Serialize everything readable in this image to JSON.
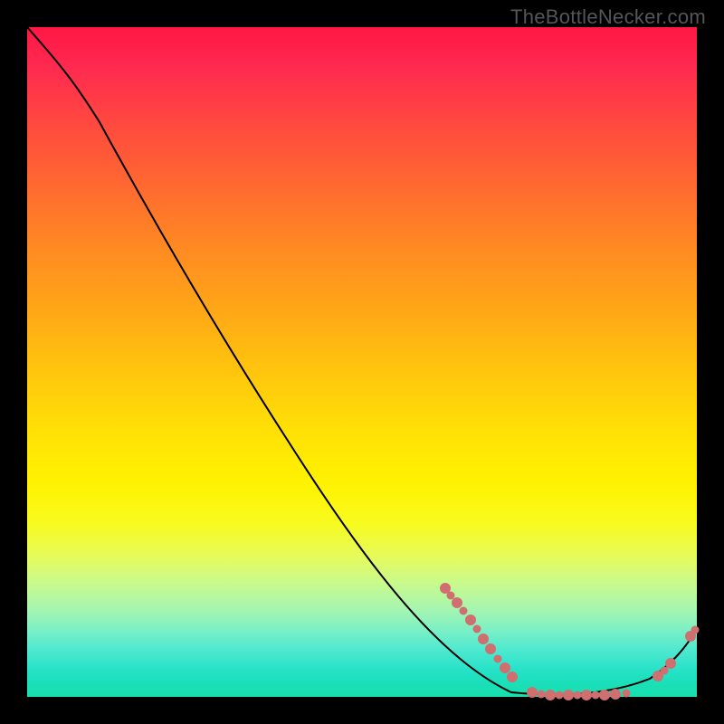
{
  "watermark": "TheBottleNecker.com",
  "chart_data": {
    "type": "line",
    "title": "",
    "xlabel": "",
    "ylabel": "",
    "xlim": [
      0,
      100
    ],
    "ylim": [
      0,
      100
    ],
    "background_gradient": {
      "direction": "vertical",
      "stops": [
        {
          "pos": 0.0,
          "color": "#ff1744"
        },
        {
          "pos": 0.5,
          "color": "#ffd400"
        },
        {
          "pos": 0.75,
          "color": "#f5fb30"
        },
        {
          "pos": 1.0,
          "color": "#18dfad"
        }
      ]
    },
    "series": [
      {
        "name": "bottleneck-curve",
        "render": "line",
        "color": "#000000",
        "x": [
          0,
          5,
          11,
          20,
          30,
          40,
          50,
          60,
          68,
          73,
          80,
          87,
          93,
          100
        ],
        "values": [
          100,
          94,
          86,
          72,
          56,
          42,
          29,
          18,
          10,
          5,
          1,
          0,
          3,
          10
        ]
      },
      {
        "name": "highlighted-points",
        "render": "scatter",
        "color": "#cf6f6f",
        "x": [
          62,
          63,
          64,
          65,
          66,
          67,
          68,
          69,
          70,
          71,
          72,
          75,
          76.5,
          78,
          79.5,
          81,
          82.5,
          84,
          85.5,
          87,
          88,
          89.5,
          94,
          95,
          96,
          99,
          100
        ],
        "values": [
          16,
          15,
          14,
          13,
          12,
          10.5,
          9,
          7.5,
          6,
          4.5,
          3,
          0.7,
          0.4,
          0.3,
          0.3,
          0.3,
          0.3,
          0.3,
          0.3,
          0.4,
          0.5,
          0.6,
          3,
          4,
          5,
          9,
          10
        ]
      }
    ]
  }
}
